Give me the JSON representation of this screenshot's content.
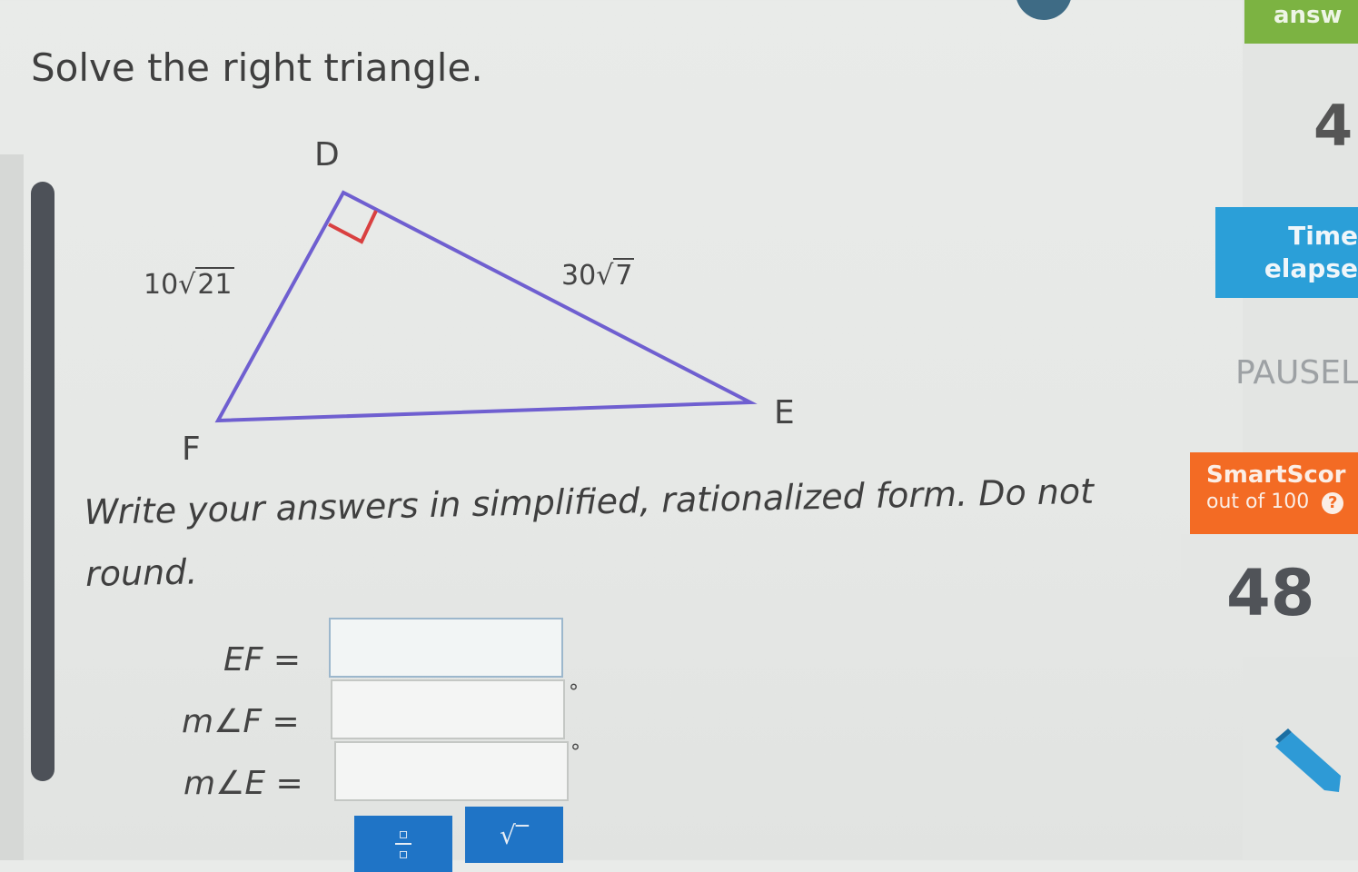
{
  "question": {
    "title": "Solve the right triangle.",
    "instructions": "Write your answers in simplified, rationalized form. Do not round.",
    "diagram": {
      "vertices": {
        "top": "D",
        "left": "F",
        "right": "E"
      },
      "side_DF": {
        "coefficient": "10",
        "radicand": "21"
      },
      "side_DE": {
        "coefficient": "30",
        "radicand": "7"
      },
      "right_angle_at": "D"
    },
    "answers": [
      {
        "label": "EF =",
        "value": "",
        "unit": ""
      },
      {
        "label": "m∠F =",
        "value": "",
        "unit": "°"
      },
      {
        "label": "m∠E =",
        "value": "",
        "unit": "°"
      }
    ],
    "toolbar": {
      "fraction_icon": "fraction-icon",
      "sqrt_label": "√‾"
    }
  },
  "sidebar": {
    "answered_label": "answ",
    "answered_count": "4",
    "time_label": "Time",
    "time_sub": "elapse",
    "paused": "PAUSEL",
    "smartscore_label": "SmartScor",
    "smartscore_sub": "out of 100",
    "smartscore_value": "48"
  },
  "colors": {
    "triangle": "#6f5fd0",
    "right_angle_marker": "#d94040",
    "answered": "#7cb342",
    "time": "#2b9fd8",
    "smartscore": "#f36b24",
    "tool_button": "#1f74c6",
    "pencil": "#2e9ad6"
  }
}
